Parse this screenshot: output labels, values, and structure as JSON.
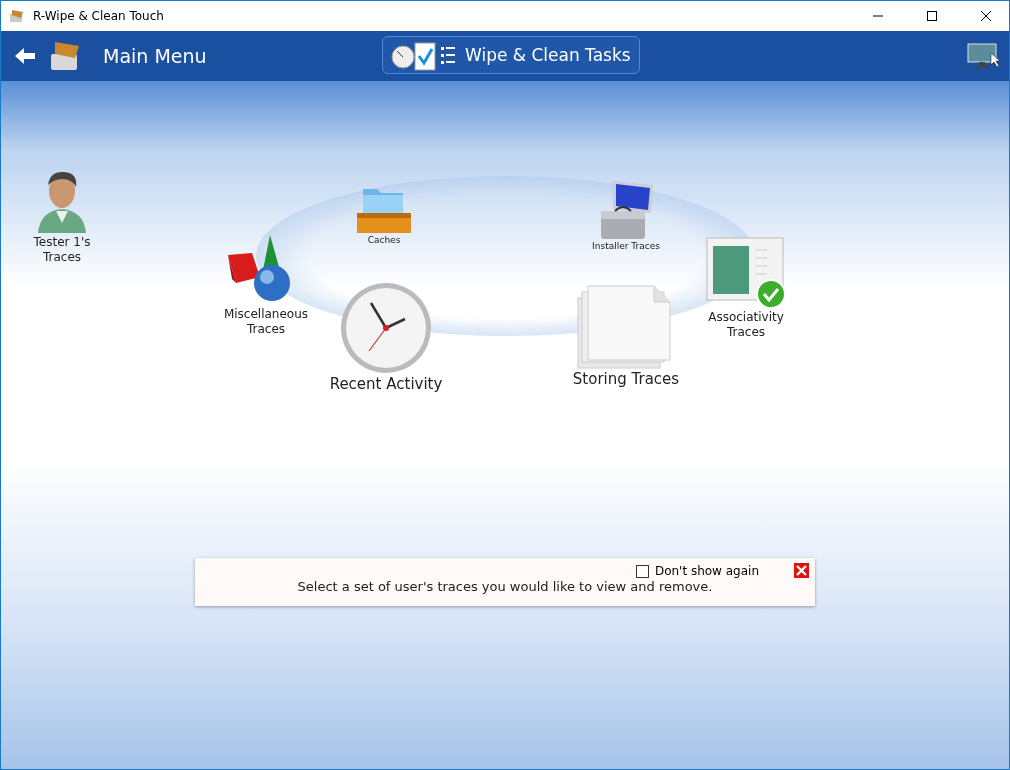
{
  "window": {
    "title": "R-Wipe & Clean Touch"
  },
  "header": {
    "back_label": "Main Menu",
    "center_button": "Wipe & Clean Tasks"
  },
  "items": [
    {
      "kind": "user",
      "label": "Tester 1's Traces"
    },
    {
      "kind": "caches",
      "label": "Caches"
    },
    {
      "kind": "installer",
      "label": "Installer Traces"
    },
    {
      "kind": "misc",
      "label": "Miscellaneous Traces"
    },
    {
      "kind": "assoc",
      "label": "Associativity Traces"
    },
    {
      "kind": "clock",
      "label": "Recent Activity"
    },
    {
      "kind": "pages",
      "label": "Storing Traces"
    }
  ],
  "hint": {
    "text": "Select a set of user's traces you would like to view and remove.",
    "checkbox": {
      "label": "Don't show again",
      "checked": false
    }
  }
}
